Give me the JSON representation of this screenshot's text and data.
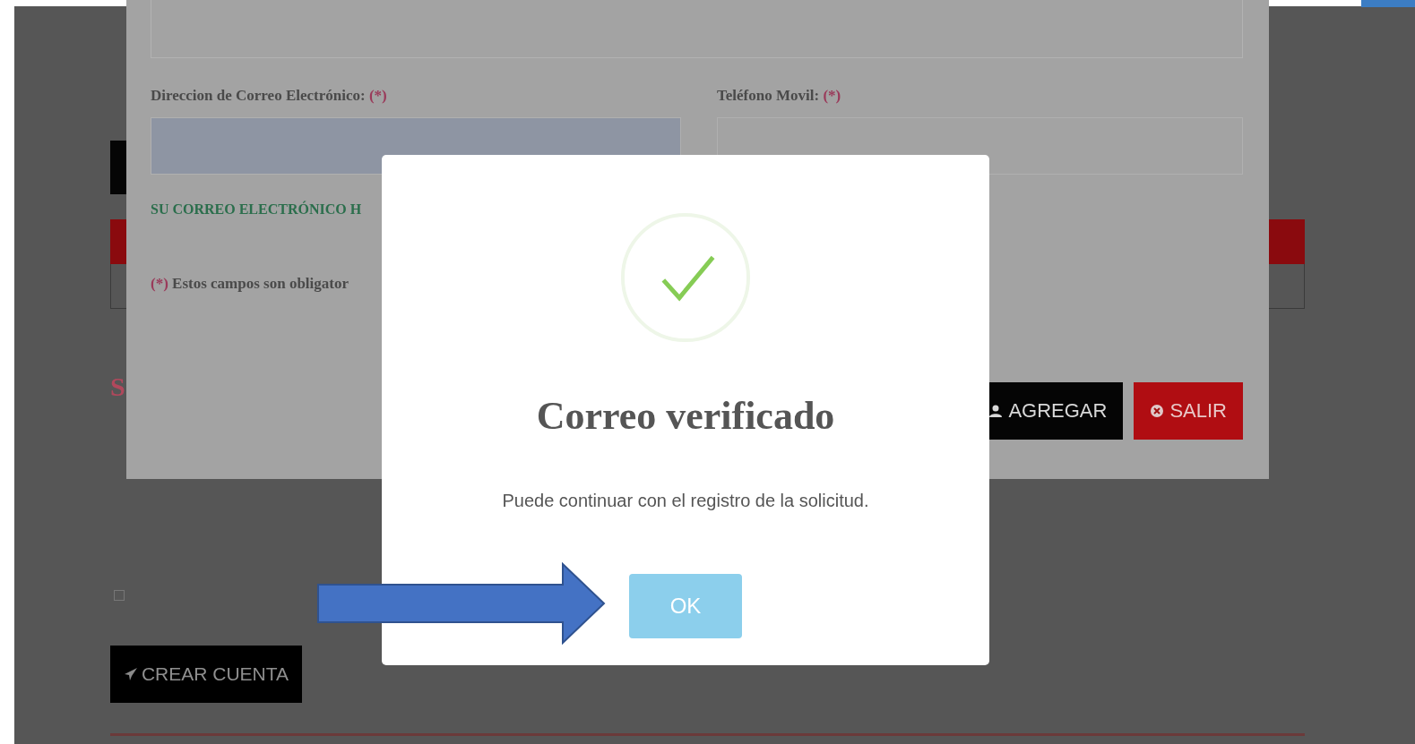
{
  "form_dialog": {
    "email_label": "Direccion de Correo Electrónico:",
    "email_required": "(*)",
    "phone_label": "Teléfono Movil:",
    "phone_required": "(*)",
    "email_status": "SU CORREO ELECTRÓNICO H",
    "required_note_mark": "(*)",
    "required_note": "Estos campos son obligator",
    "buttons": [
      {
        "label": "AGREGAR",
        "kind": "add"
      },
      {
        "label": "SALIR",
        "kind": "exit"
      }
    ]
  },
  "page": {
    "section_heading": "S",
    "terms_checkbox": {
      "checked": false
    },
    "create_button": "CREAR CUENTA"
  },
  "alert": {
    "title": "Correo verificado",
    "message": "Puede continuar con el registro de la solicitud.",
    "confirm_button": "OK"
  }
}
